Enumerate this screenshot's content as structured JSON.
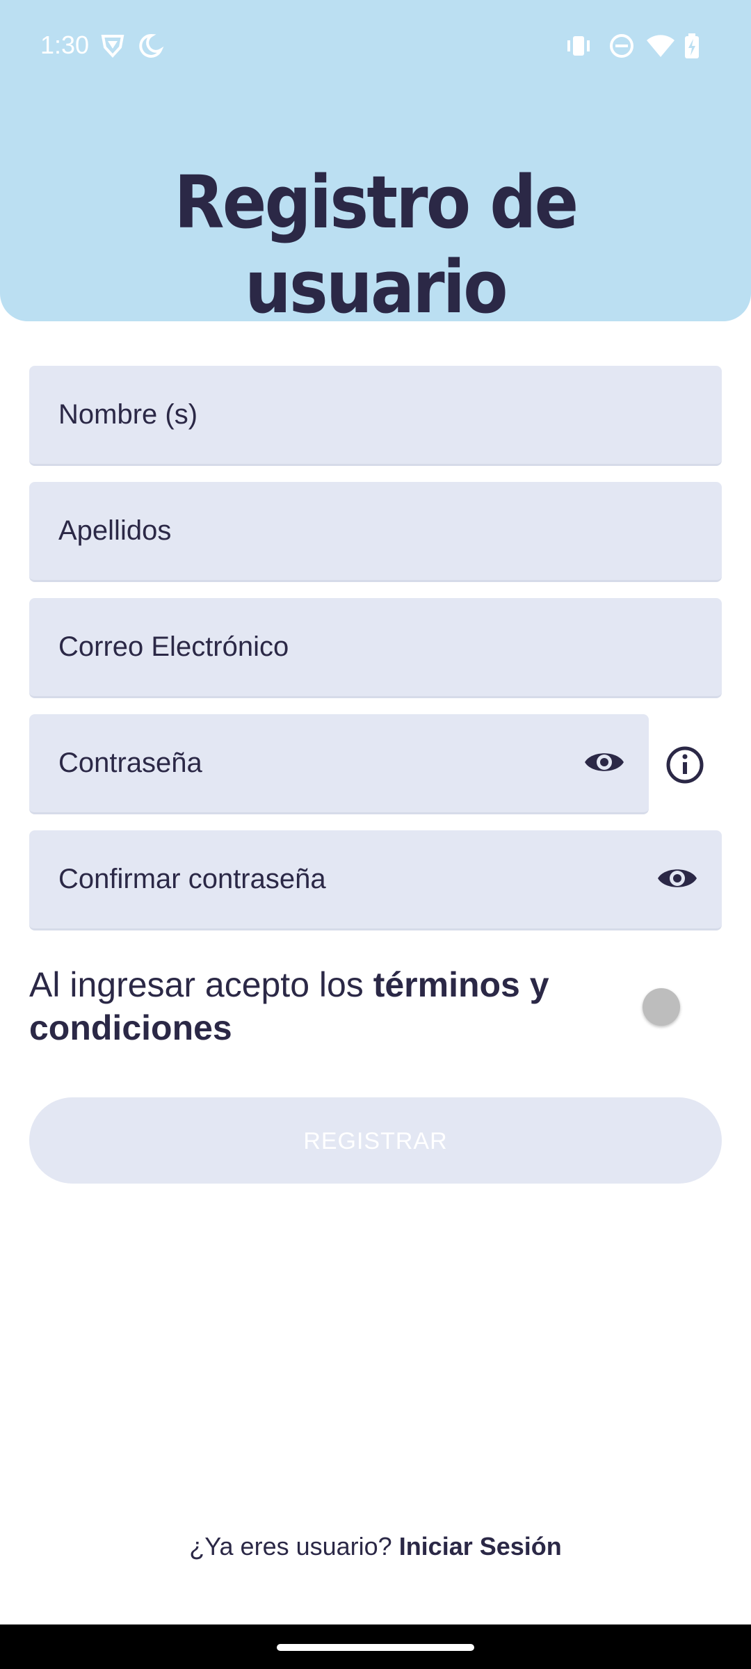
{
  "status_bar": {
    "time": "1:30",
    "left_icons": [
      "shield-icon",
      "bedtime-moon-icon"
    ],
    "right_icons": [
      "vibrate-icon",
      "do-not-disturb-icon",
      "wifi-icon",
      "battery-charging-icon"
    ]
  },
  "header": {
    "title": "Registro de usuario",
    "background_color": "#bbdff2"
  },
  "form": {
    "first_name": {
      "placeholder": "Nombre (s)",
      "value": ""
    },
    "last_name": {
      "placeholder": "Apellidos",
      "value": ""
    },
    "email": {
      "placeholder": "Correo Electrónico",
      "value": ""
    },
    "password": {
      "placeholder": "Contraseña",
      "value": "",
      "visibility_icon": "eye-icon",
      "help_icon": "info-icon"
    },
    "confirm_password": {
      "placeholder": "Confirmar contraseña",
      "value": "",
      "visibility_icon": "eye-icon"
    }
  },
  "terms": {
    "prefix": "Al ingresar acepto los ",
    "link_text": "términos y condiciones",
    "accepted": false
  },
  "register_button": {
    "label": "REGISTRAR",
    "enabled": false
  },
  "footer": {
    "prompt": "¿Ya eres usuario? ",
    "login_link": "Iniciar Sesión"
  },
  "colors": {
    "field_background": "#e3e7f3",
    "text": "#2b2846",
    "toggle_off": "#bdbdbd"
  }
}
